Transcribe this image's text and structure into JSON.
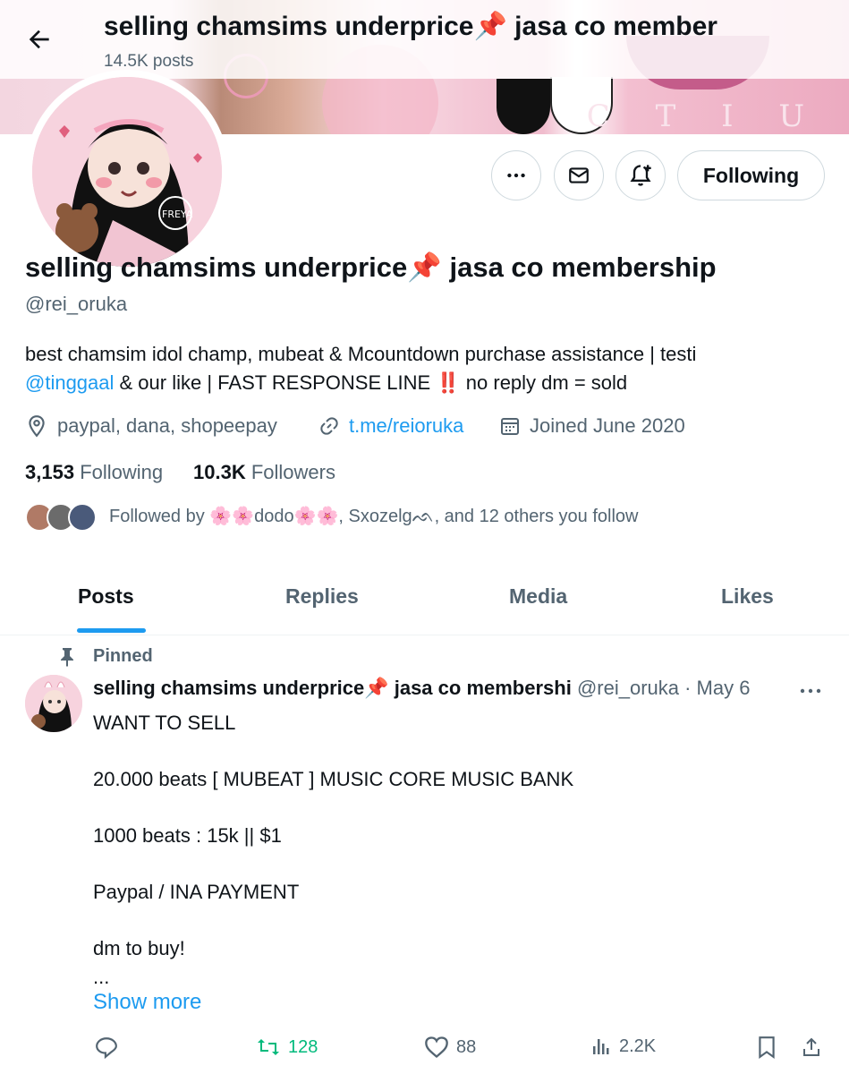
{
  "header": {
    "title": "selling chamsims underprice📌 jasa co member",
    "post_count": "14.5K posts"
  },
  "banner": {
    "letters": "C T I U"
  },
  "avatar": {
    "label": "FREYA"
  },
  "actions": {
    "following_label": "Following"
  },
  "profile": {
    "display_name": "selling chamsims underprice📌 jasa co membership",
    "handle": "@rei_oruka",
    "bio_line1": "best chamsim idol champ, mubeat & Mcountdown purchase assistance | testi",
    "bio_mention": "@tinggaal",
    "bio_line2_rest": " & our like | FAST RESPONSE LINE ‼️ no reply dm = sold",
    "location": "paypal, dana, shopeepay",
    "website": "t.me/reioruka",
    "joined": "Joined June 2020",
    "following_count": "3,153",
    "following_label": "Following",
    "followers_count": "10.3K",
    "followers_label": "Followers",
    "followed_by": "Followed by 🌸🌸dodo🌸🌸, Sxozelgᨒ, and 12 others you follow"
  },
  "tabs": [
    {
      "label": "Posts"
    },
    {
      "label": "Replies"
    },
    {
      "label": "Media"
    },
    {
      "label": "Likes"
    }
  ],
  "post": {
    "pinned_label": "Pinned",
    "author_name": "selling chamsims underprice📌 jasa co membershi",
    "author_handle_date": "@rei_oruka · May 6",
    "body": "WANT TO SELL\n\n20.000 beats [ MUBEAT ] MUSIC CORE MUSIC BANK\n\n1000 beats : 15k || $1\n\nPaypal / INA PAYMENT\n\ndm to buy!\n...",
    "show_more": "Show more",
    "reposts": "128",
    "likes": "88",
    "views": "2.2K"
  },
  "colors": {
    "accent": "#1d9bf0",
    "secondary_text": "#536471",
    "repost_green": "#00ba7c"
  }
}
